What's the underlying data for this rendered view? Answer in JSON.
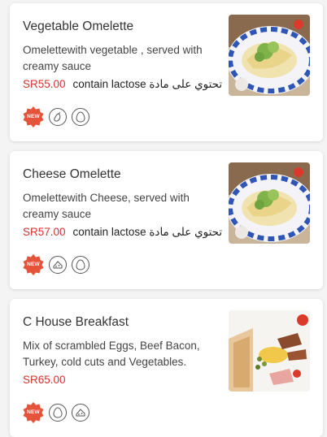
{
  "items": [
    {
      "title": "Vegetable Omelette",
      "description": "Omelettewith vegetable , served with creamy sauce",
      "price": "SR55.00",
      "note": "contain lactose تحتوي على مادة ...",
      "badge": "NEW",
      "icons": [
        "new-badge-icon",
        "eggplant-icon",
        "egg-icon"
      ]
    },
    {
      "title": "Cheese Omelette",
      "description": "Omelettewith Cheese, served with creamy sauce",
      "price": "SR57.00",
      "note": "contain lactose تحتوي على مادة ...",
      "badge": "NEW",
      "icons": [
        "new-badge-icon",
        "cheese-icon",
        "egg-icon"
      ]
    },
    {
      "title": "C House Breakfast",
      "description": "Mix of scrambled Eggs, Beef Bacon, Turkey, cold cuts and Vegetables.",
      "price": "SR65.00",
      "note": "",
      "badge": "NEW",
      "icons": [
        "new-badge-icon",
        "egg-icon",
        "cheese-icon"
      ]
    }
  ],
  "colors": {
    "price": "#d9302c",
    "badge": "#e5533a"
  }
}
